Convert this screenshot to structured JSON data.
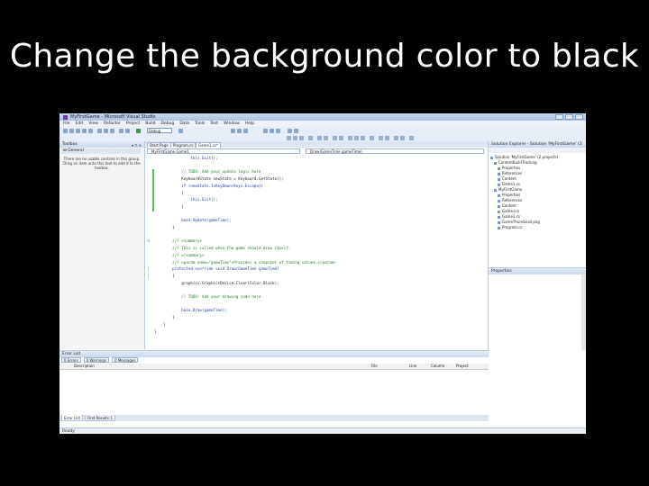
{
  "slide": {
    "title": "Change the background color to black"
  },
  "window": {
    "title": "MyFirstGame - Microsoft Visual Studio"
  },
  "menu": [
    "File",
    "Edit",
    "View",
    "Refactor",
    "Project",
    "Build",
    "Debug",
    "Data",
    "Tools",
    "Test",
    "Window",
    "Help"
  ],
  "toolbar": {
    "configuration": "Debug"
  },
  "toolbox": {
    "title": "Toolbox",
    "group": "General",
    "message": "There are no usable controls in this group. Drag an item onto this text to add it to the toolbox.",
    "tabs": [
      "Server Explorer",
      "Toolbox"
    ]
  },
  "editor": {
    "tabs": [
      "Start Page",
      "Program.cs",
      "Game1.cs*"
    ],
    "class_dropdown": "MyFirstGame.Game1",
    "member_dropdown": "Draw(GameTime gameTime)",
    "lines": [
      "                this.Exit();",
      "",
      "            // TODO: Add your update logic here",
      "            KeyboardState newState = Keyboard.GetState();",
      "            if (newState.IsKeyDown(Keys.Escape))",
      "            {",
      "                this.Exit();",
      "            }",
      "",
      "            base.Update(gameTime);",
      "        }",
      "",
      "        /// <summary>",
      "        /// This is called when the game should draw itself.",
      "        /// </summary>",
      "        /// <param name=\"gameTime\">Provides a snapshot of timing values.</param>",
      "        protected override void Draw(GameTime gameTime)",
      "        {",
      "            graphics.GraphicsDevice.Clear(Color.Black);",
      "",
      "            // TODO: Add your drawing code here",
      "",
      "            base.Draw(gameTime);",
      "        }",
      "    }",
      "}"
    ]
  },
  "solution_explorer": {
    "title": "Solution Explorer - Solution 'MyFirstGame' (2 projects)",
    "items": [
      "Solution 'MyFirstGame' (2 projects)",
      "ContentBuildTracking",
      "Properties",
      "References",
      "Content",
      "Game1.cs",
      "MyFirstGame",
      "Properties",
      "References",
      "Content",
      "Game.ico",
      "Game1.cs",
      "GameThumbnail.png",
      "Program.cs"
    ]
  },
  "properties": {
    "title": "Properties"
  },
  "error_list": {
    "title": "Error List",
    "tabs": [
      "0 Errors",
      "0 Warnings",
      "0 Messages"
    ],
    "columns": [
      "Description",
      "File",
      "Line",
      "Column",
      "Project"
    ]
  },
  "bottom_tabs": [
    "Error List",
    "Find Results 1"
  ],
  "status": {
    "text": "Ready"
  }
}
